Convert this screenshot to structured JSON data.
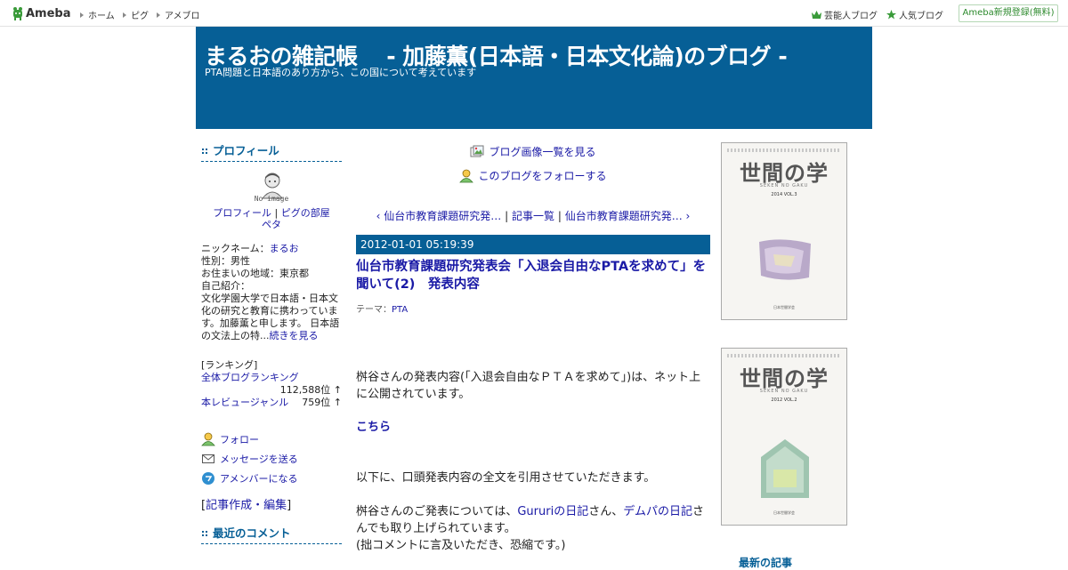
{
  "topbar": {
    "logo_text": "Ameba",
    "nav": [
      "ホーム",
      "ピグ",
      "アメブロ"
    ],
    "celeb_blog": "芸能人ブログ",
    "popular_blog": "人気ブログ",
    "register": "Ameba新規登録(無料)"
  },
  "header": {
    "title": "まるおの雑記帳　 - 加藤薫(日本語・日本文化論)のブログ -",
    "subtitle": "PTA問題と日本語のあり方から、この国について考えています"
  },
  "sidebar": {
    "profile_heading": "プロフィール",
    "no_image": "No image",
    "profile_link": "プロフィール",
    "pig_room_link": "ピグの部屋",
    "peta_link": "ペタ",
    "nickname_label": "ニックネーム：",
    "nickname": "まるお",
    "gender": "性別：男性",
    "region": "お住まいの地域：東京都",
    "intro_label": "自己紹介：",
    "intro_text": "文化学園大学で日本語・日本文化の研究と教育に携わっています。加藤薫と申します。 日本語の文法上の特...",
    "read_more": "続きを見る",
    "ranking_label": "[ランキング]",
    "ranking_overall_label": "全体ブログランキング",
    "ranking_overall_value": "112,588位 ↑",
    "ranking_genre_label": "本レビュージャンル",
    "ranking_genre_value": "759位 ↑",
    "follow": "フォロー",
    "send_message": "メッセージを送る",
    "amember": "アメンバーになる",
    "edit_bracket_open": "[",
    "edit_link": "記事作成・編集",
    "edit_bracket_close": "]",
    "recent_comments_heading": "最近のコメント"
  },
  "main": {
    "image_list": "ブログ画像一覧を見る",
    "follow_blog": "このブログをフォローする",
    "prev_entry": "仙台市教育課題研究発…",
    "entry_list": "記事一覧",
    "next_entry": "仙台市教育課題研究発…",
    "separator": "|",
    "date": "2012-01-01 05:19:39",
    "entry_title": "仙台市教育課題研究発表会「入退会自由なPTAを求めて」を聞いて(2)　発表内容",
    "theme_label": "テーマ：",
    "theme": "PTA",
    "body_p1": "桝谷さんの発表内容(「入退会自由なＰＴＡを求めて」)は、ネット上に公開されています。",
    "body_link": "こちら",
    "body_p2": "以下に、口頭発表内容の全文を引用させていただきます。",
    "body_p3_a": "桝谷さんのご発表については、",
    "body_p3_link1": "Gururiの日記",
    "body_p3_b": "さん、",
    "body_p3_link2": "デムパの日記",
    "body_p3_c": "さんでも取り上げられています。",
    "body_p4": "(拙コメントに言及いただき、恐縮です。)"
  },
  "right": {
    "magazines": [
      {
        "title": "世間の学",
        "sub": "SEKEN NO GAKU",
        "vol": "2014 VOL.3",
        "publisher": "日本世間学会"
      },
      {
        "title": "世間の学",
        "sub": "SEKEN NO GAKU",
        "vol": "2012 VOL.2",
        "publisher": "日本世間学会"
      }
    ],
    "latest_heading": "最新の記事"
  },
  "colors": {
    "header_bg": "#065f96",
    "link": "#1a1aa6"
  }
}
